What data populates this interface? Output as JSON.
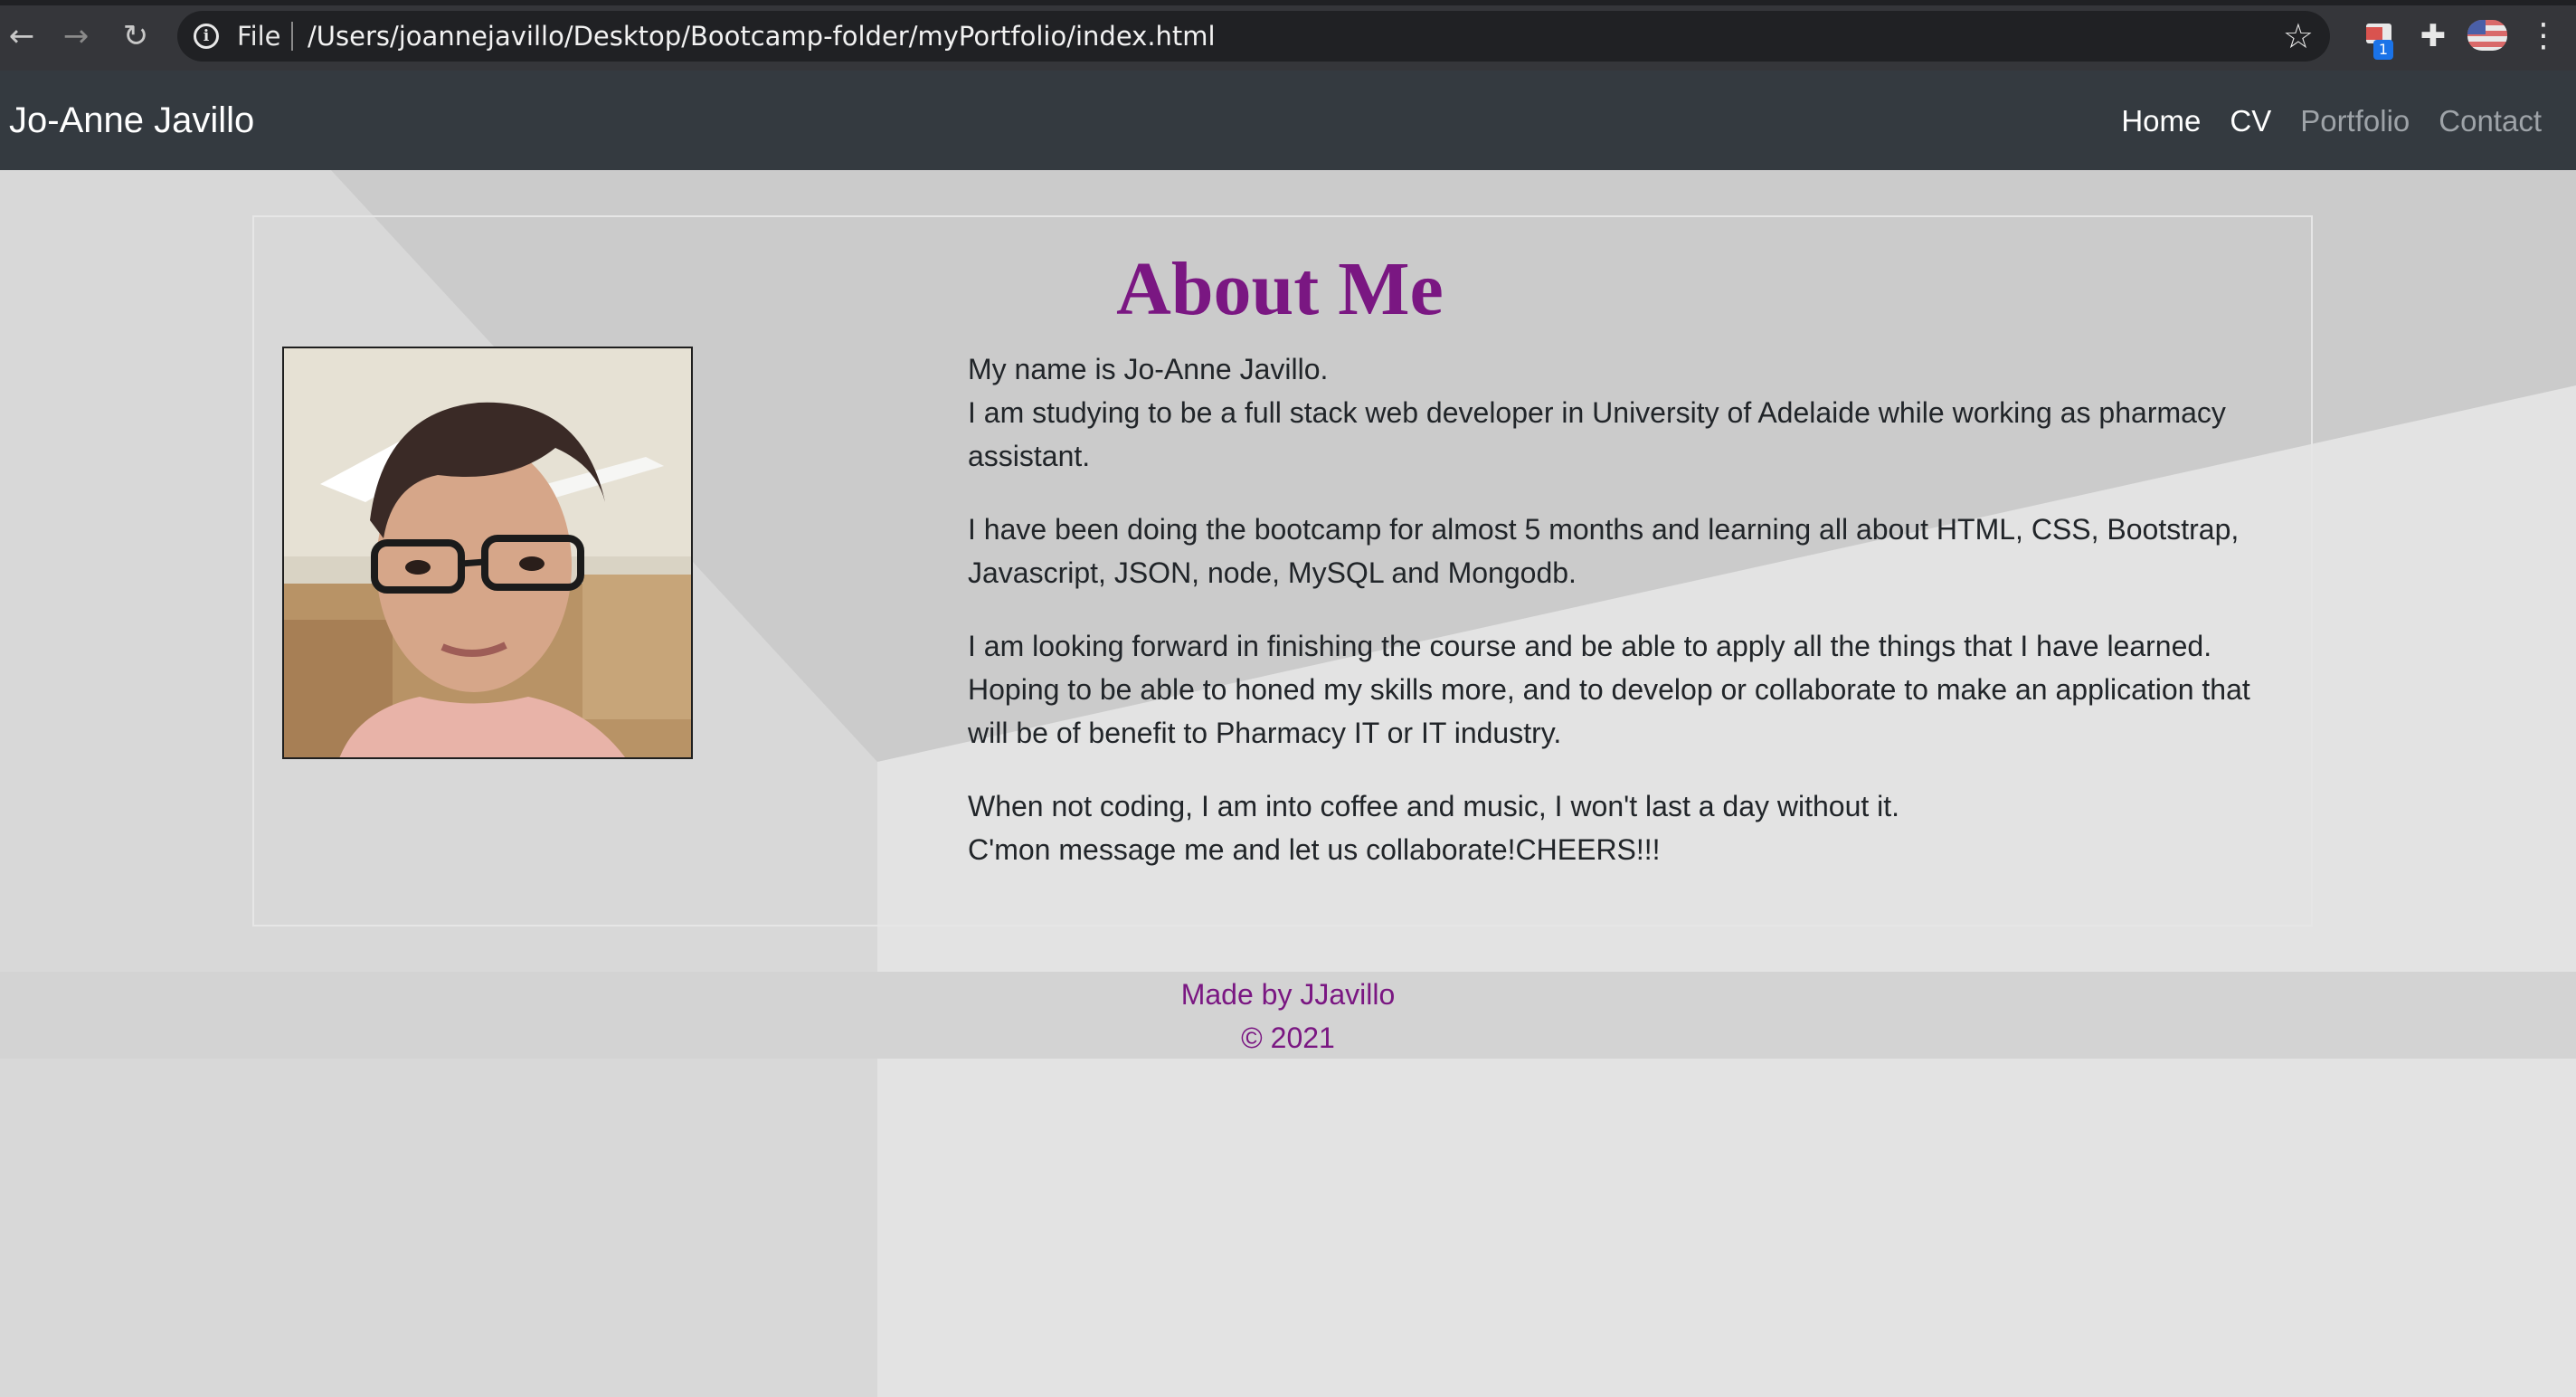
{
  "browser": {
    "scheme_label": "File",
    "url": "/Users/joannejavillo/Desktop/Bootcamp-folder/myPortfolio/index.html",
    "extension_badge": "1",
    "icons": [
      "back-arrow-icon",
      "forward-arrow-icon",
      "reload-icon",
      "info-icon",
      "star-icon",
      "extension-icon",
      "puzzle-icon",
      "profile-icon",
      "menu-dots-icon"
    ]
  },
  "navbar": {
    "brand": "Jo-Anne Javillo",
    "links": [
      {
        "label": "Home",
        "active": true
      },
      {
        "label": "CV",
        "active": true
      },
      {
        "label": "Portfolio",
        "active": false
      },
      {
        "label": "Contact",
        "active": false
      }
    ]
  },
  "about": {
    "title": "About Me",
    "paragraphs": [
      [
        "My name is Jo-Anne Javillo.",
        "I am studying to be a full stack web developer in University of Adelaide while working as pharmacy",
        "assistant."
      ],
      [
        "I have been doing the bootcamp for almost 5 months and learning all about HTML, CSS, Bootstrap,",
        "Javascript, JSON, node, MySQL and Mongodb."
      ],
      [
        "I am looking forward in finishing the course and be able to apply all the things that I have learned.",
        "Hoping to be able to honed my skills more, and to develop or collaborate to make an application that",
        "will be of benefit to Pharmacy IT or IT industry."
      ],
      [
        "When not coding, I am into coffee and music, I won't last a day without it.",
        "C'mon message me and let us collaborate!CHEERS!!!"
      ]
    ]
  },
  "footer": {
    "line1": "Made by JJavillo",
    "line2": "© 2021"
  },
  "colors": {
    "navbar_bg": "#343a40",
    "accent_purple": "#7a1782",
    "browser_bg": "#35363a"
  }
}
